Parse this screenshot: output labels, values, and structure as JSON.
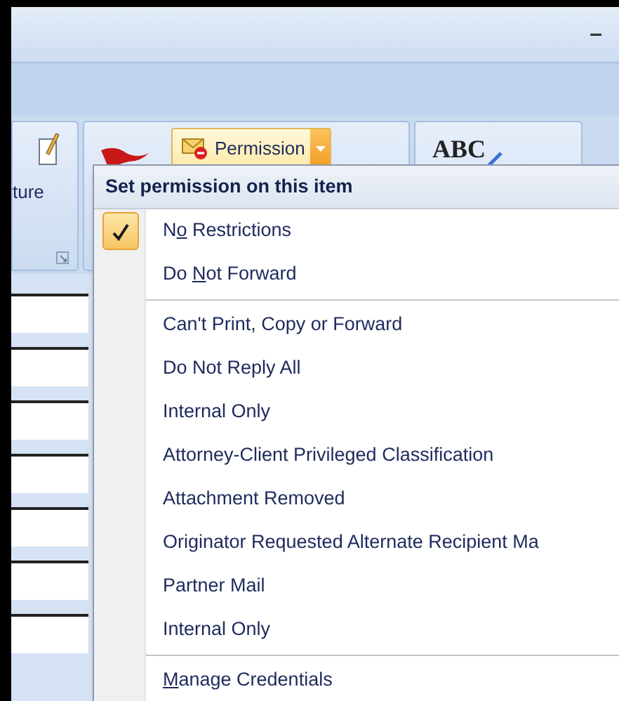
{
  "title_bar": {
    "minimize_glyph": "–"
  },
  "ribbon": {
    "left_group_label": "ture",
    "spelling_label": "ABC",
    "permission_button": {
      "label": "Permission",
      "pressed": true
    }
  },
  "menu": {
    "header": "Set permission on this item",
    "items": [
      {
        "kind": "option",
        "text_before": "N",
        "access_key": "o",
        "text_after": " Restrictions",
        "checked": true
      },
      {
        "kind": "option",
        "text_before": "Do ",
        "access_key": "N",
        "text_after": "ot Forward",
        "checked": false
      },
      {
        "kind": "separator"
      },
      {
        "kind": "option",
        "label": "Can't Print, Copy or Forward",
        "checked": false
      },
      {
        "kind": "option",
        "label": "Do Not Reply All",
        "checked": false
      },
      {
        "kind": "option",
        "label": "Internal Only",
        "checked": false
      },
      {
        "kind": "option",
        "label": "Attorney-Client Privileged Classification",
        "checked": false
      },
      {
        "kind": "option",
        "label": "Attachment Removed",
        "checked": false
      },
      {
        "kind": "option",
        "label": "Originator Requested Alternate Recipient Ma",
        "checked": false
      },
      {
        "kind": "option",
        "label": "Partner Mail",
        "checked": false
      },
      {
        "kind": "option",
        "label": "Internal Only",
        "checked": false
      },
      {
        "kind": "separator"
      },
      {
        "kind": "option",
        "access_key": "M",
        "text_after": "anage Credentials",
        "checked": false
      }
    ]
  }
}
